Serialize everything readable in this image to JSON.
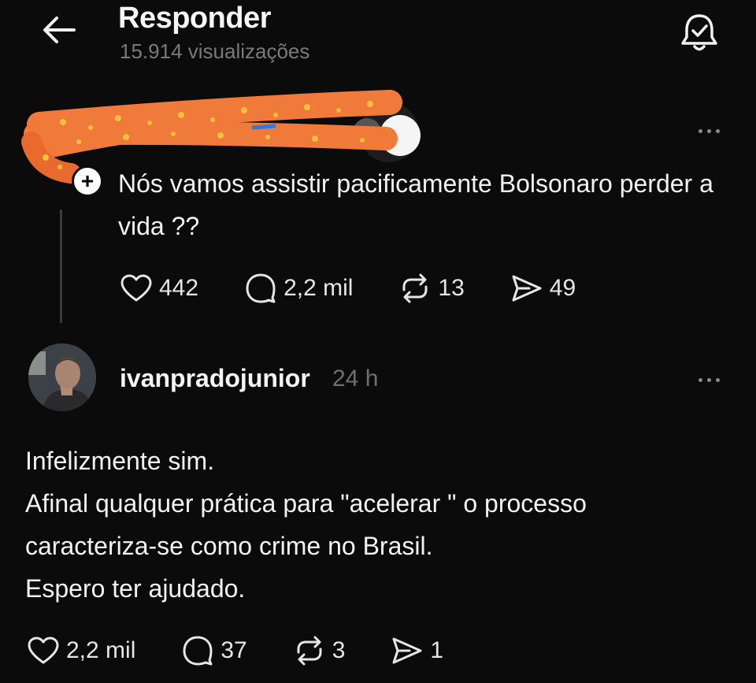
{
  "header": {
    "title": "Responder",
    "subtitle": "15.914 visualizações"
  },
  "parent_post": {
    "text": "Nós vamos assistir pacificamente Bolsonaro perder a vida ??",
    "likes": "442",
    "replies": "2,2 mil",
    "reposts": "13",
    "shares": "49"
  },
  "reply": {
    "username": "ivanpradojunior",
    "time": "24 h",
    "lines": [
      "Infelizmente sim.",
      "Afinal qualquer prática para \"acelerar \" o processo",
      "caracteriza-se como crime no Brasil.",
      "Espero ter ajudado."
    ],
    "likes": "2,2 mil",
    "replies": "37",
    "reposts": "3",
    "shares": "1"
  },
  "icons": {
    "back": "arrow-left-icon",
    "notify": "bell-check-icon",
    "like": "heart-icon",
    "reply": "speech-bubble-icon",
    "repost": "repost-icon",
    "share": "paper-plane-icon",
    "more": "more-dots-icon"
  },
  "colors": {
    "background": "#0b0b0b",
    "text": "#f3f3f3",
    "muted": "#7a7a7a",
    "scribble_orange": "#f07a3a",
    "scribble_yellow": "#f3c23a"
  }
}
